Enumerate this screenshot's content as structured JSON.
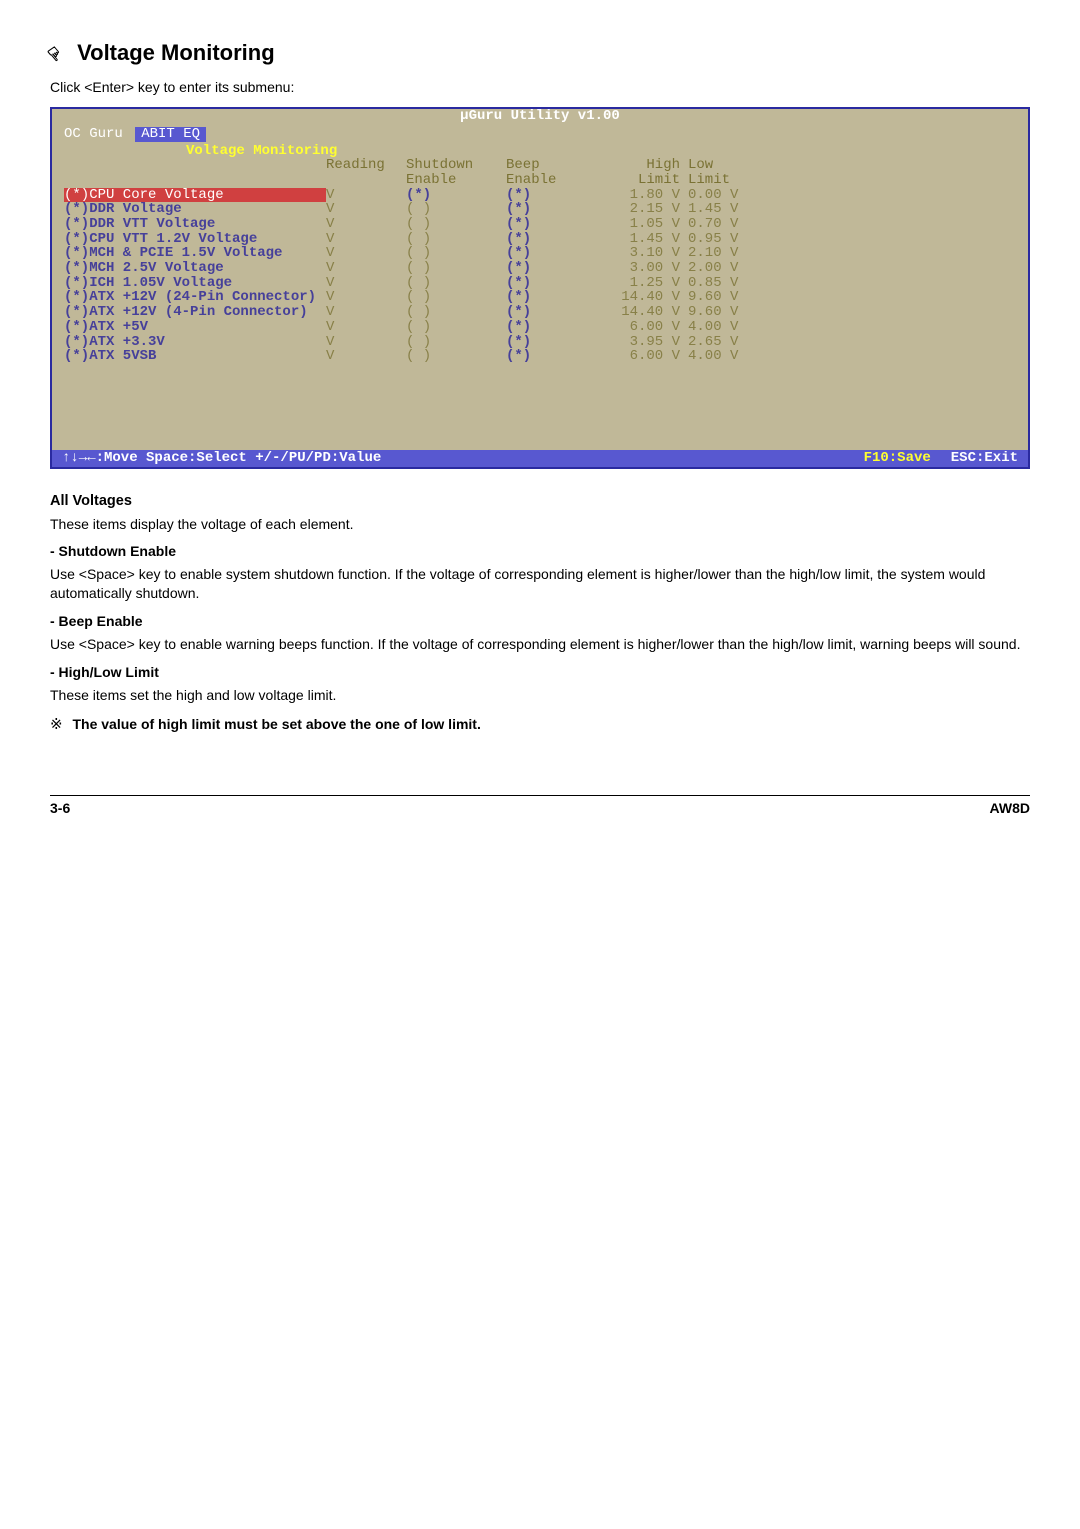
{
  "heading": "Voltage Monitoring",
  "intro": "Click <Enter> key to enter its submenu:",
  "bios": {
    "title": "µGuru Utility v1.00",
    "oc_guru": "OC Guru",
    "tab": "ABIT EQ",
    "section": "Voltage Monitoring",
    "headers": {
      "reading": "Reading",
      "shutdown": "Shutdown",
      "shutdown2": "Enable",
      "beep": "Beep",
      "beep2": "Enable",
      "high": "High",
      "high2": "Limit",
      "low": "Low",
      "low2": "Limit"
    },
    "rows": [
      {
        "sel": true,
        "name": "(*)CPU Core Voltage",
        "reading": "V",
        "shutdown": "(*)",
        "beep": "(*)",
        "high": "1.80 V",
        "low": "0.00 V"
      },
      {
        "sel": false,
        "name": "(*)DDR Voltage",
        "reading": "V",
        "shutdown": "( )",
        "beep": "(*)",
        "high": "2.15 V",
        "low": "1.45 V"
      },
      {
        "sel": false,
        "name": "(*)DDR VTT Voltage",
        "reading": "V",
        "shutdown": "( )",
        "beep": "(*)",
        "high": "1.05 V",
        "low": "0.70 V"
      },
      {
        "sel": false,
        "name": "(*)CPU VTT 1.2V Voltage",
        "reading": "V",
        "shutdown": "( )",
        "beep": "(*)",
        "high": "1.45 V",
        "low": "0.95 V"
      },
      {
        "sel": false,
        "name": "(*)MCH & PCIE 1.5V Voltage",
        "reading": "V",
        "shutdown": "( )",
        "beep": "(*)",
        "high": "3.10 V",
        "low": "2.10 V"
      },
      {
        "sel": false,
        "name": "(*)MCH 2.5V Voltage",
        "reading": "V",
        "shutdown": "( )",
        "beep": "(*)",
        "high": "3.00 V",
        "low": "2.00 V"
      },
      {
        "sel": false,
        "name": "(*)ICH 1.05V Voltage",
        "reading": "V",
        "shutdown": "( )",
        "beep": "(*)",
        "high": "1.25 V",
        "low": "0.85 V"
      },
      {
        "sel": false,
        "name": "(*)ATX +12V (24-Pin Connector)",
        "reading": "V",
        "shutdown": "( )",
        "beep": "(*)",
        "high": "14.40 V",
        "low": "9.60 V"
      },
      {
        "sel": false,
        "name": "(*)ATX +12V (4-Pin Connector)",
        "reading": "V",
        "shutdown": "( )",
        "beep": "(*)",
        "high": "14.40 V",
        "low": "9.60 V"
      },
      {
        "sel": false,
        "name": "(*)ATX +5V",
        "reading": "V",
        "shutdown": "( )",
        "beep": "(*)",
        "high": "6.00 V",
        "low": "4.00 V"
      },
      {
        "sel": false,
        "name": "(*)ATX +3.3V",
        "reading": "V",
        "shutdown": "( )",
        "beep": "(*)",
        "high": "3.95 V",
        "low": "2.65 V"
      },
      {
        "sel": false,
        "name": "(*)ATX 5VSB",
        "reading": "V",
        "shutdown": "( )",
        "beep": "(*)",
        "high": "6.00 V",
        "low": "4.00 V"
      }
    ],
    "footer": {
      "left": "↑↓→←:Move  Space:Select  +/-/PU/PD:Value",
      "save": "F10:Save",
      "exit": "ESC:Exit"
    }
  },
  "sections": {
    "all_voltages_h": "All Voltages",
    "all_voltages_p": "These items display the voltage of each element.",
    "shutdown_h": "-  Shutdown Enable",
    "shutdown_p": "Use <Space> key to enable system shutdown function. If the voltage of corresponding element is higher/lower than the high/low limit, the system would automatically shutdown.",
    "beep_h": "-  Beep Enable",
    "beep_p": "Use <Space> key to enable warning beeps function. If the voltage of corresponding element is higher/lower than the high/low limit, warning beeps will sound.",
    "hl_h": "-  High/Low Limit",
    "hl_p": "These items set the high and low voltage limit.",
    "note": "The value of high limit must be set above the one of low limit."
  },
  "footer": {
    "page": "3-6",
    "model": "AW8D"
  }
}
